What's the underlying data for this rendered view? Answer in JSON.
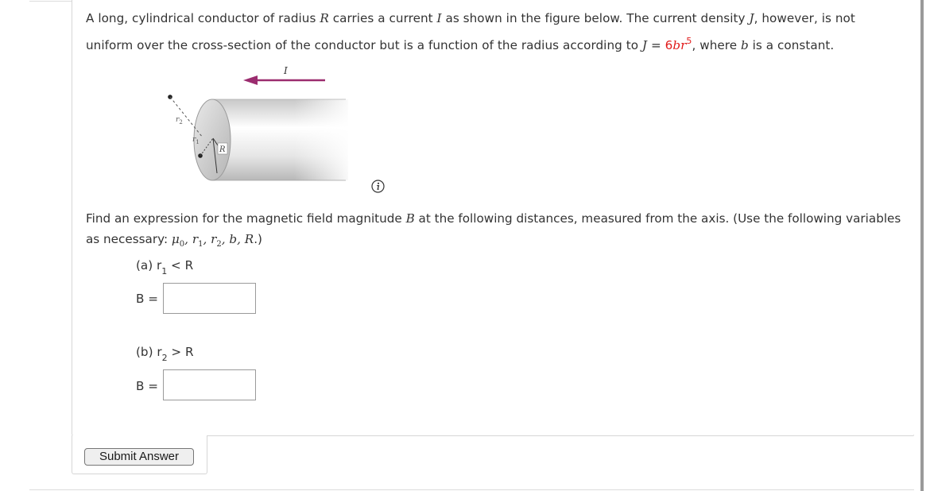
{
  "problem": {
    "intro_1": "A long, cylindrical conductor of radius ",
    "var_R": "R",
    "intro_2": " carries a current ",
    "var_I": "I",
    "intro_3": " as shown in the figure below. The current density ",
    "var_J": "J",
    "intro_4": ", however, is not uniform over the cross-section of the conductor but is a function of the radius according to ",
    "eq_J": "J",
    "eq_equals": " = ",
    "eq_coef": "6",
    "eq_br": "br",
    "eq_exp": "5",
    "intro_5": ", where ",
    "var_b": "b",
    "intro_6": " is a constant."
  },
  "figure": {
    "label_I": "I",
    "label_r2": "r",
    "label_r2_sub": "2",
    "label_r1": "r",
    "label_r1_sub": "1",
    "label_R": "R",
    "arrow_color": "#9b2c6f"
  },
  "question": {
    "text_1": "Find an expression for the magnetic field magnitude ",
    "var_B": "B",
    "text_2": " at the following distances, measured from the axis. (Use the following variables as necessary: ",
    "vars": "μ",
    "vars_mu_sub": "0",
    "vars_rest_1": ", r",
    "vars_r1_sub": "1",
    "vars_rest_2": ", r",
    "vars_r2_sub": "2",
    "vars_rest_3": ", b, R",
    "text_3": ".)"
  },
  "part_a": {
    "label": "(a) r",
    "sub": "1",
    "cond": " < R",
    "b_label": "B =",
    "value": ""
  },
  "part_b": {
    "label": "(b) r",
    "sub": "2",
    "cond": " > R",
    "b_label": "B =",
    "value": ""
  },
  "submit": {
    "label": "Submit Answer"
  }
}
